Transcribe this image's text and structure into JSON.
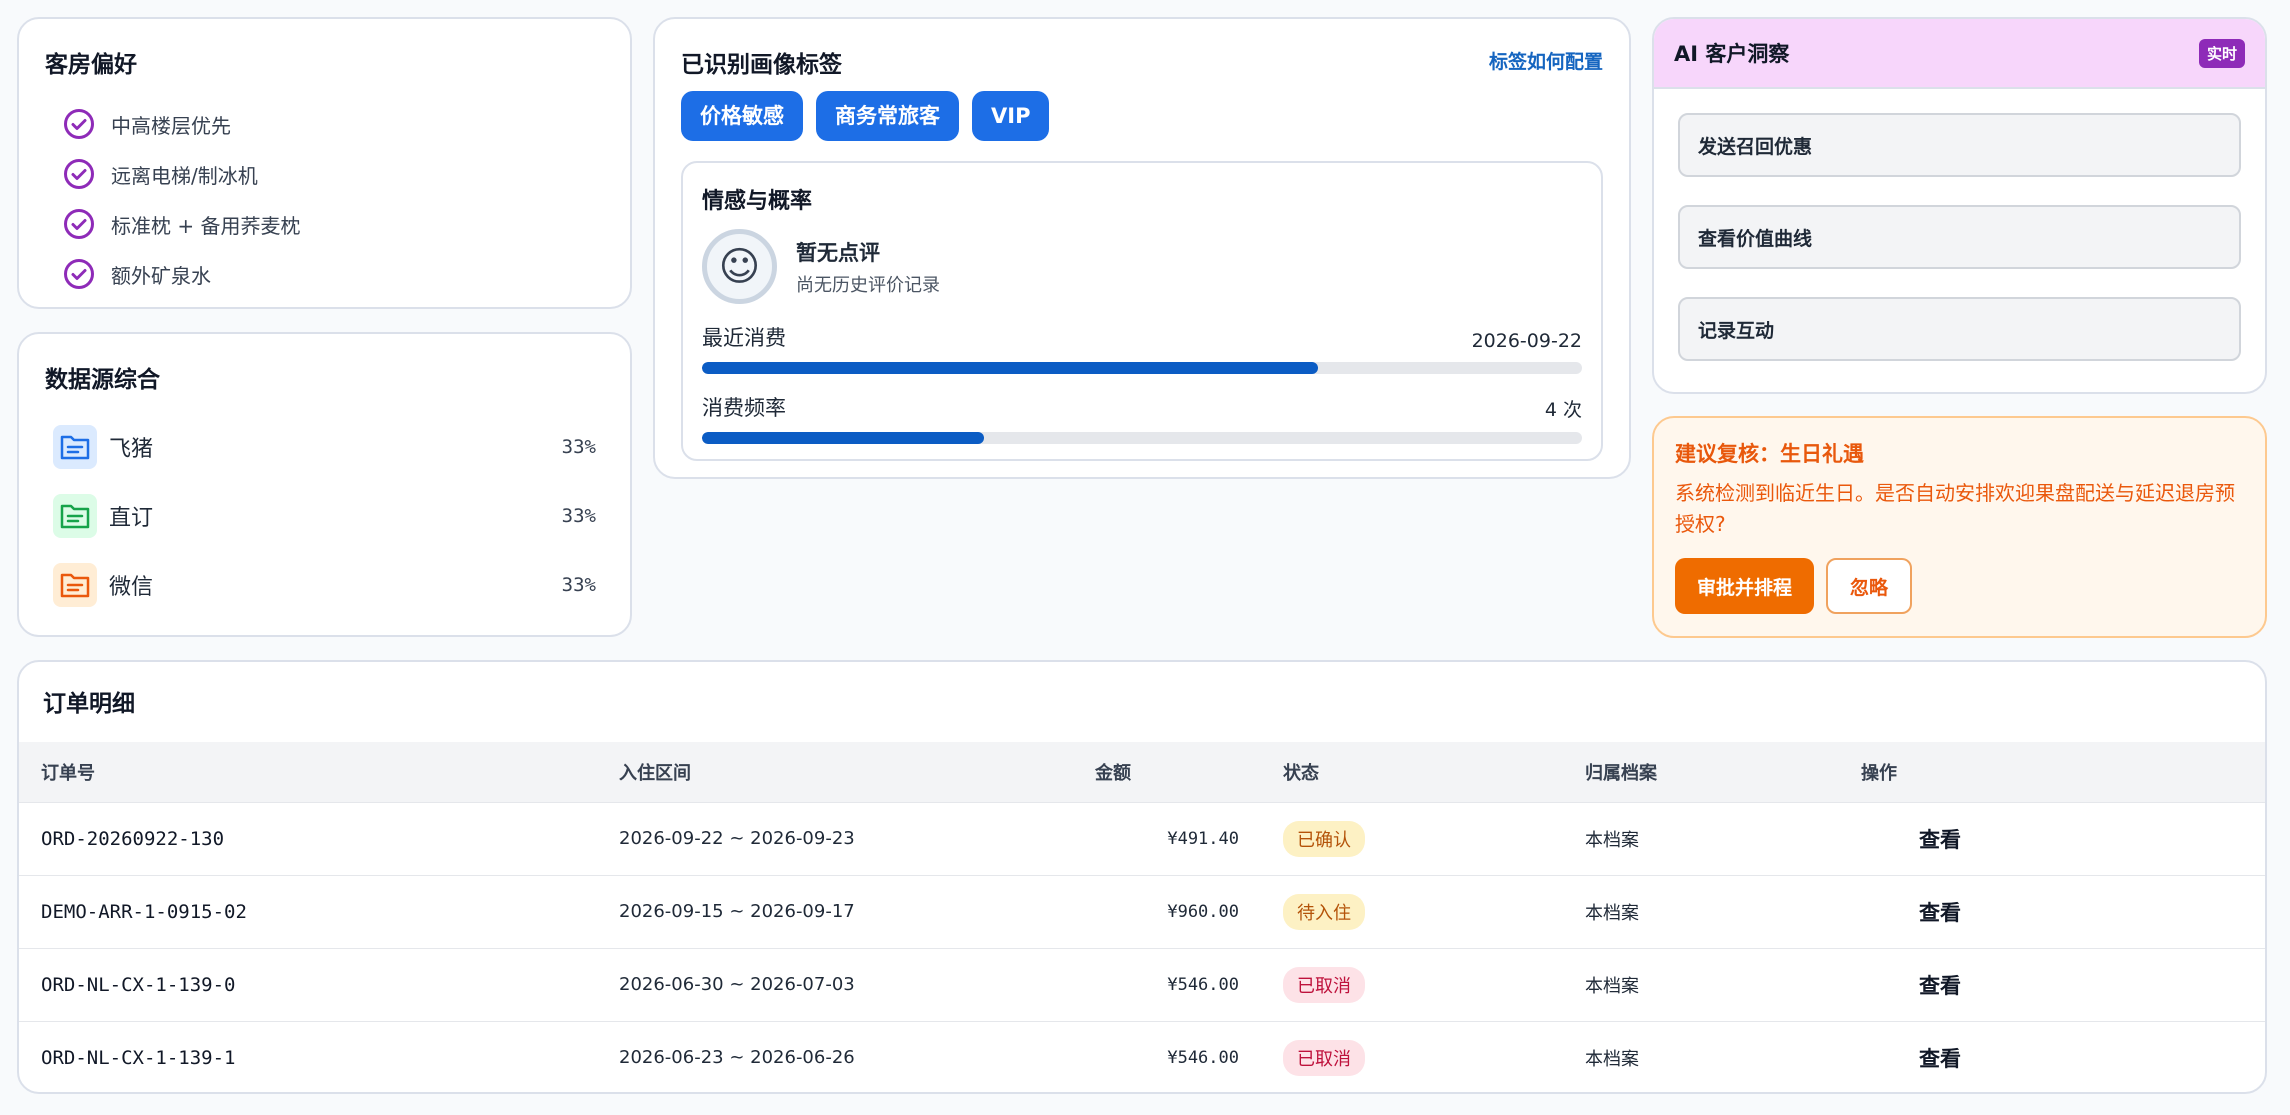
{
  "prefs": {
    "title": "客房偏好",
    "items": [
      "中高楼层优先",
      "远离电梯/制冰机",
      "标准枕 + 备用荞麦枕",
      "额外矿泉水"
    ]
  },
  "sources": {
    "title": "数据源综合",
    "items": [
      {
        "name": "飞猪",
        "pct": "33%",
        "color": "#1d6ee6",
        "bg": "#dbeafe",
        "icon": "folder-icon"
      },
      {
        "name": "直订",
        "pct": "33%",
        "color": "#16a34a",
        "bg": "#dcfce7",
        "icon": "folder-icon"
      },
      {
        "name": "微信",
        "pct": "33%",
        "color": "#ea580c",
        "bg": "#ffedd5",
        "icon": "folder-icon"
      }
    ]
  },
  "tags": {
    "title": "已识别画像标签",
    "link": "标签如何配置",
    "chips": [
      "价格敏感",
      "商务常旅客",
      "VIP"
    ]
  },
  "sentiment": {
    "title": "情感与概率",
    "icon": "smile-face-icon",
    "main": "暂无点评",
    "sub": "尚无历史评价记录",
    "metrics": [
      {
        "label": "最近消费",
        "value": "2026-09-22",
        "fill": 0.7
      },
      {
        "label": "消费频率",
        "value": "4 次",
        "fill": 0.32
      }
    ]
  },
  "ai": {
    "title": "AI 客户洞察",
    "badge": "实时",
    "actions": [
      "发送召回优惠",
      "查看价值曲线",
      "记录互动"
    ]
  },
  "suggest": {
    "title": "建议复核：生日礼遇",
    "text": "系统检测到临近生日。是否自动安排欢迎果盘配送与延迟退房预授权?",
    "approve": "审批并排程",
    "ignore": "忽略"
  },
  "orders": {
    "title": "订单明细",
    "headers": [
      "订单号",
      "入住区间",
      "金额",
      "状态",
      "归属档案",
      "操作"
    ],
    "rows": [
      {
        "id": "ORD-20260922-130",
        "range": "2026-09-22 ~ 2026-09-23",
        "amount": "¥491.40",
        "status": "已确认",
        "status_kind": "confirmed",
        "owner": "本档案",
        "action": "查看"
      },
      {
        "id": "DEMO-ARR-1-0915-02",
        "range": "2026-09-15 ~ 2026-09-17",
        "amount": "¥960.00",
        "status": "待入住",
        "status_kind": "pending",
        "owner": "本档案",
        "action": "查看"
      },
      {
        "id": "ORD-NL-CX-1-139-0",
        "range": "2026-06-30 ~ 2026-07-03",
        "amount": "¥546.00",
        "status": "已取消",
        "status_kind": "cancelled",
        "owner": "本档案",
        "action": "查看"
      },
      {
        "id": "ORD-NL-CX-1-139-1",
        "range": "2026-06-23 ~ 2026-06-26",
        "amount": "¥546.00",
        "status": "已取消",
        "status_kind": "cancelled",
        "owner": "本档案",
        "action": "查看"
      }
    ]
  },
  "colors": {
    "accent": "#1d6ee6",
    "check": "#8e2bb8",
    "bar": "#0b5cc4",
    "warn": "#ef6c00"
  }
}
